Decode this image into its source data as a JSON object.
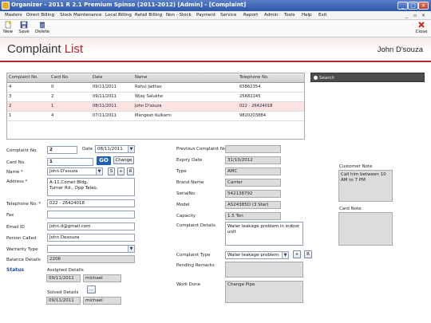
{
  "window": {
    "title": "Organizer - 2011 R 2.1 Premium Spinso (2011-2012) [Admin] - [Complaint]"
  },
  "menu": [
    "Masters",
    "Direct Billing",
    "Stock Maintenance",
    "Local Billing",
    "Retail Billing",
    "Non - Stock",
    "Payment",
    "Service",
    "Report",
    "Admin",
    "Tools",
    "Help",
    "Exit"
  ],
  "toolbar": {
    "new_label": "New",
    "save_label": "Save",
    "delete_label": "Delete",
    "close_label": "Close"
  },
  "header": {
    "title_main": "Complaint",
    "title_accent": "List",
    "user": "John D'souza"
  },
  "search": {
    "placeholder": "Search"
  },
  "grid": {
    "headers": [
      "Complaint No.",
      "Card No.",
      "Date",
      "Name",
      "Telephone No."
    ],
    "rows": [
      [
        "4",
        "0",
        "09/11/2011",
        "Rahul Jadhav",
        "65862354"
      ],
      [
        "3",
        "2",
        "09/11/2011",
        "Wjay Salukhe",
        "25682145"
      ],
      [
        "2",
        "1",
        "08/11/2011",
        "John D'souza",
        "022 - 26424018"
      ],
      [
        "1",
        "4",
        "07/11/2011",
        "Mangesh Kulkarni",
        "9820203884"
      ]
    ]
  },
  "form": {
    "complaint_no_label": "Complaint No.",
    "complaint_no": "2",
    "date_label": "Date",
    "date": "08/11/2011",
    "card_no_label": "Card No.",
    "card_no": "1",
    "go_label": "GO",
    "change_label": "Change",
    "name_label": "Name *",
    "name": "John D'souza",
    "s_label": "S",
    "plus_label": "+",
    "r_label": "R",
    "address_label": "Address *",
    "address": "A-11,Comet Bldg,\nTurner Rd., Opp Talao,",
    "telephone_label": "Telephone No. *",
    "telephone": "022 - 26424018",
    "fax_label": "Fax",
    "fax": "",
    "email_label": "Email ID",
    "email": "John.d@gmail.com",
    "person_called_label": "Person Called",
    "person_called": "John Desouza",
    "warranty_label": "Warranty Type",
    "warranty": "",
    "balance_label": "Balance Details",
    "balance": "2206"
  },
  "status": {
    "label": "Status",
    "assigned_label": "Assigned Details",
    "assigned_date": "09/11/2011",
    "assigned_to": "michael",
    "solved_label": "Solved Details",
    "solved_btn": "...",
    "solved_date": "09/11/2011",
    "solved_by": "michael"
  },
  "product": {
    "prev_complaint_label": "Previous Complaint No.",
    "prev_complaint": "",
    "expiry_label": "Expiry Date",
    "expiry": "31/10/2012",
    "type_label": "Type",
    "type": "AMC",
    "brand_label": "Brand Name",
    "brand": "Carrier",
    "serial_label": "SerialNo",
    "serial": "542138792",
    "model_label": "Model",
    "model": "AS24385D (3 Star)",
    "capacity_label": "Capacity",
    "capacity": "1.5 Ton",
    "details_label": "Complaint Details",
    "details": "Water leakage problem in indoor unit",
    "ctype_label": "Complaint Type",
    "ctype": "Water leakage problem",
    "pending_label": "Pending Remarks",
    "pending": "",
    "work_label": "Work Done",
    "work": "Change Pipe"
  },
  "notes": {
    "customer_label": "Customer Note",
    "customer": "Call him between 10 AM to 7 PM",
    "card_label": "Card Note",
    "card": ""
  }
}
